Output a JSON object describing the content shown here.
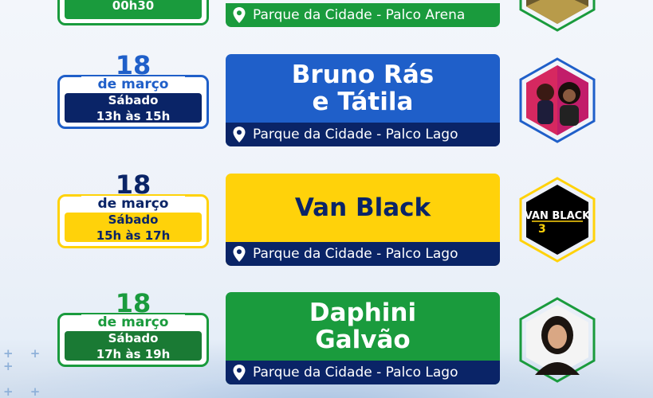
{
  "top": {
    "time": "00h30",
    "location": "Parque da Cidade - Palco Arena"
  },
  "events": [
    {
      "day": "18",
      "month": "de março",
      "weekday": "Sábado",
      "time": "13h às 15h",
      "artist_line1": "Bruno Rás",
      "artist_line2": "e Tátila",
      "location": "Parque da Cidade - Palco Lago",
      "theme_color": "#1f5fc9",
      "band_color": "#0a2467"
    },
    {
      "day": "18",
      "month": "de março",
      "weekday": "Sábado",
      "time": "15h às 17h",
      "artist_line1": "Van Black",
      "artist_line2": "",
      "location": "Parque da Cidade - Palco Lago",
      "theme_color": "#ffd20a",
      "band_color": "#ffd20a"
    },
    {
      "day": "18",
      "month": "de março",
      "weekday": "Sábado",
      "time": "17h às 19h",
      "artist_line1": "Daphini",
      "artist_line2": "Galvão",
      "location": "Parque da Cidade - Palco Lago",
      "theme_color": "#1a9b3d",
      "band_color": "#1a7a34"
    }
  ],
  "logo_text": "VAN BLACK",
  "colors": {
    "navy": "#0a2467",
    "blue": "#1f5fc9",
    "yellow": "#ffd20a",
    "green": "#1a9b3d"
  },
  "icons": {
    "location": "map-pin-icon"
  }
}
